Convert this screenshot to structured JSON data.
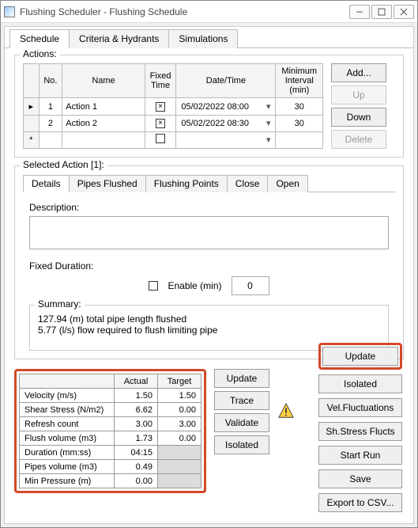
{
  "window": {
    "title": "Flushing Scheduler - Flushing Schedule"
  },
  "tabs": {
    "schedule": "Schedule",
    "criteria": "Criteria & Hydrants",
    "sim": "Simulations"
  },
  "actions": {
    "legend": "Actions:",
    "headers": {
      "no": "No.",
      "name": "Name",
      "fixed": "Fixed Time",
      "dt": "Date/Time",
      "min": "Minimum Interval (min)"
    },
    "rows": [
      {
        "no": "1",
        "name": "Action 1",
        "fixed": true,
        "dt": "05/02/2022 08:00",
        "min": "30"
      },
      {
        "no": "2",
        "name": "Action 2",
        "fixed": true,
        "dt": "05/02/2022 08:30",
        "min": "30"
      }
    ],
    "buttons": {
      "add": "Add...",
      "up": "Up",
      "down": "Down",
      "delete": "Delete"
    }
  },
  "selected": {
    "legend": "Selected Action [1]:",
    "tabs": {
      "details": "Details",
      "pipes": "Pipes Flushed",
      "points": "Flushing Points",
      "close": "Close",
      "open": "Open"
    },
    "description_label": "Description:",
    "fixed_duration_label": "Fixed Duration:",
    "enable_label": "Enable (min)",
    "enable_value": "0",
    "summary_label": "Summary:",
    "summary_line1": "127.94 (m) total pipe length flushed",
    "summary_line2": "5.77 (l/s) flow required to flush limiting pipe"
  },
  "metrics": {
    "headers": {
      "actual": "Actual",
      "target": "Target"
    },
    "rows": [
      {
        "label": "Velocity (m/s)",
        "actual": "1.50",
        "target": "1.50"
      },
      {
        "label": "Shear Stress (N/m2)",
        "actual": "6.62",
        "target": "0.00"
      },
      {
        "label": "Refresh count",
        "actual": "3.00",
        "target": "3.00"
      },
      {
        "label": "Flush volume (m3)",
        "actual": "1.73",
        "target": "0.00"
      },
      {
        "label": "Duration (mm:ss)",
        "actual": "04:15",
        "target": null
      },
      {
        "label": "Pipes volume (m3)",
        "actual": "0.49",
        "target": null
      },
      {
        "label": "Min Pressure (m)",
        "actual": "0.00",
        "target": null
      }
    ]
  },
  "mid_buttons": {
    "update": "Update",
    "trace": "Trace",
    "validate": "Validate",
    "isolated": "Isolated"
  },
  "right_buttons": {
    "update": "Update",
    "isolated": "Isolated",
    "velfluct": "Vel.Fluctuations",
    "shstress": "Sh.Stress Flucts",
    "startrun": "Start Run",
    "save": "Save",
    "export": "Export to CSV..."
  }
}
